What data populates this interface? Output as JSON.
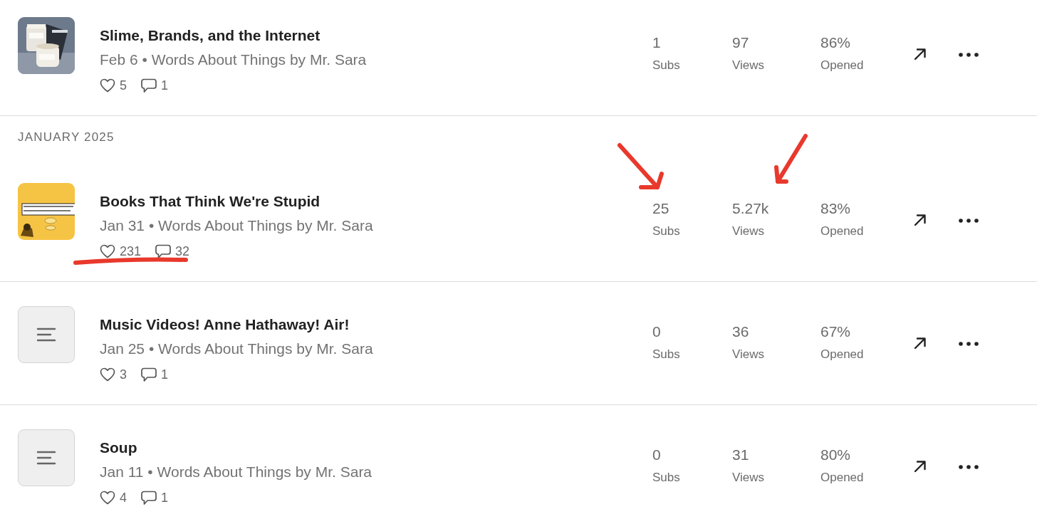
{
  "sections": [
    {
      "posts": [
        {
          "title": "Slime, Brands, and the Internet",
          "meta": "Feb 6 • Words About Things by Mr. Sara",
          "likes": "5",
          "comments": "1",
          "subs": "1",
          "subs_label": "Subs",
          "views": "97",
          "views_label": "Views",
          "opened": "86%",
          "opened_label": "Opened",
          "annotated": false
        }
      ]
    },
    {
      "heading": "JANUARY 2025",
      "posts": [
        {
          "title": "Books That Think We're Stupid",
          "meta": "Jan 31 • Words About Things by Mr. Sara",
          "likes": "231",
          "comments": "32",
          "subs": "25",
          "subs_label": "Subs",
          "views": "5.27k",
          "views_label": "Views",
          "opened": "83%",
          "opened_label": "Opened",
          "annotated": true
        },
        {
          "thumbnail": {
            "kind": "placeholder"
          },
          "title": "Music Videos! Anne Hathaway! Air!",
          "meta": "Jan 25 • Words About Things by Mr. Sara",
          "likes": "3",
          "comments": "1",
          "subs": "0",
          "subs_label": "Subs",
          "views": "36",
          "views_label": "Views",
          "opened": "67%",
          "opened_label": "Opened",
          "annotated": false
        },
        {
          "thumbnail": {
            "kind": "placeholder"
          },
          "title": "Soup",
          "meta": "Jan 11 • Words About Things by Mr. Sara",
          "likes": "4",
          "comments": "1",
          "subs": "0",
          "subs_label": "Subs",
          "views": "31",
          "views_label": "Views",
          "opened": "80%",
          "opened_label": "Opened",
          "annotated": false
        }
      ]
    }
  ]
}
